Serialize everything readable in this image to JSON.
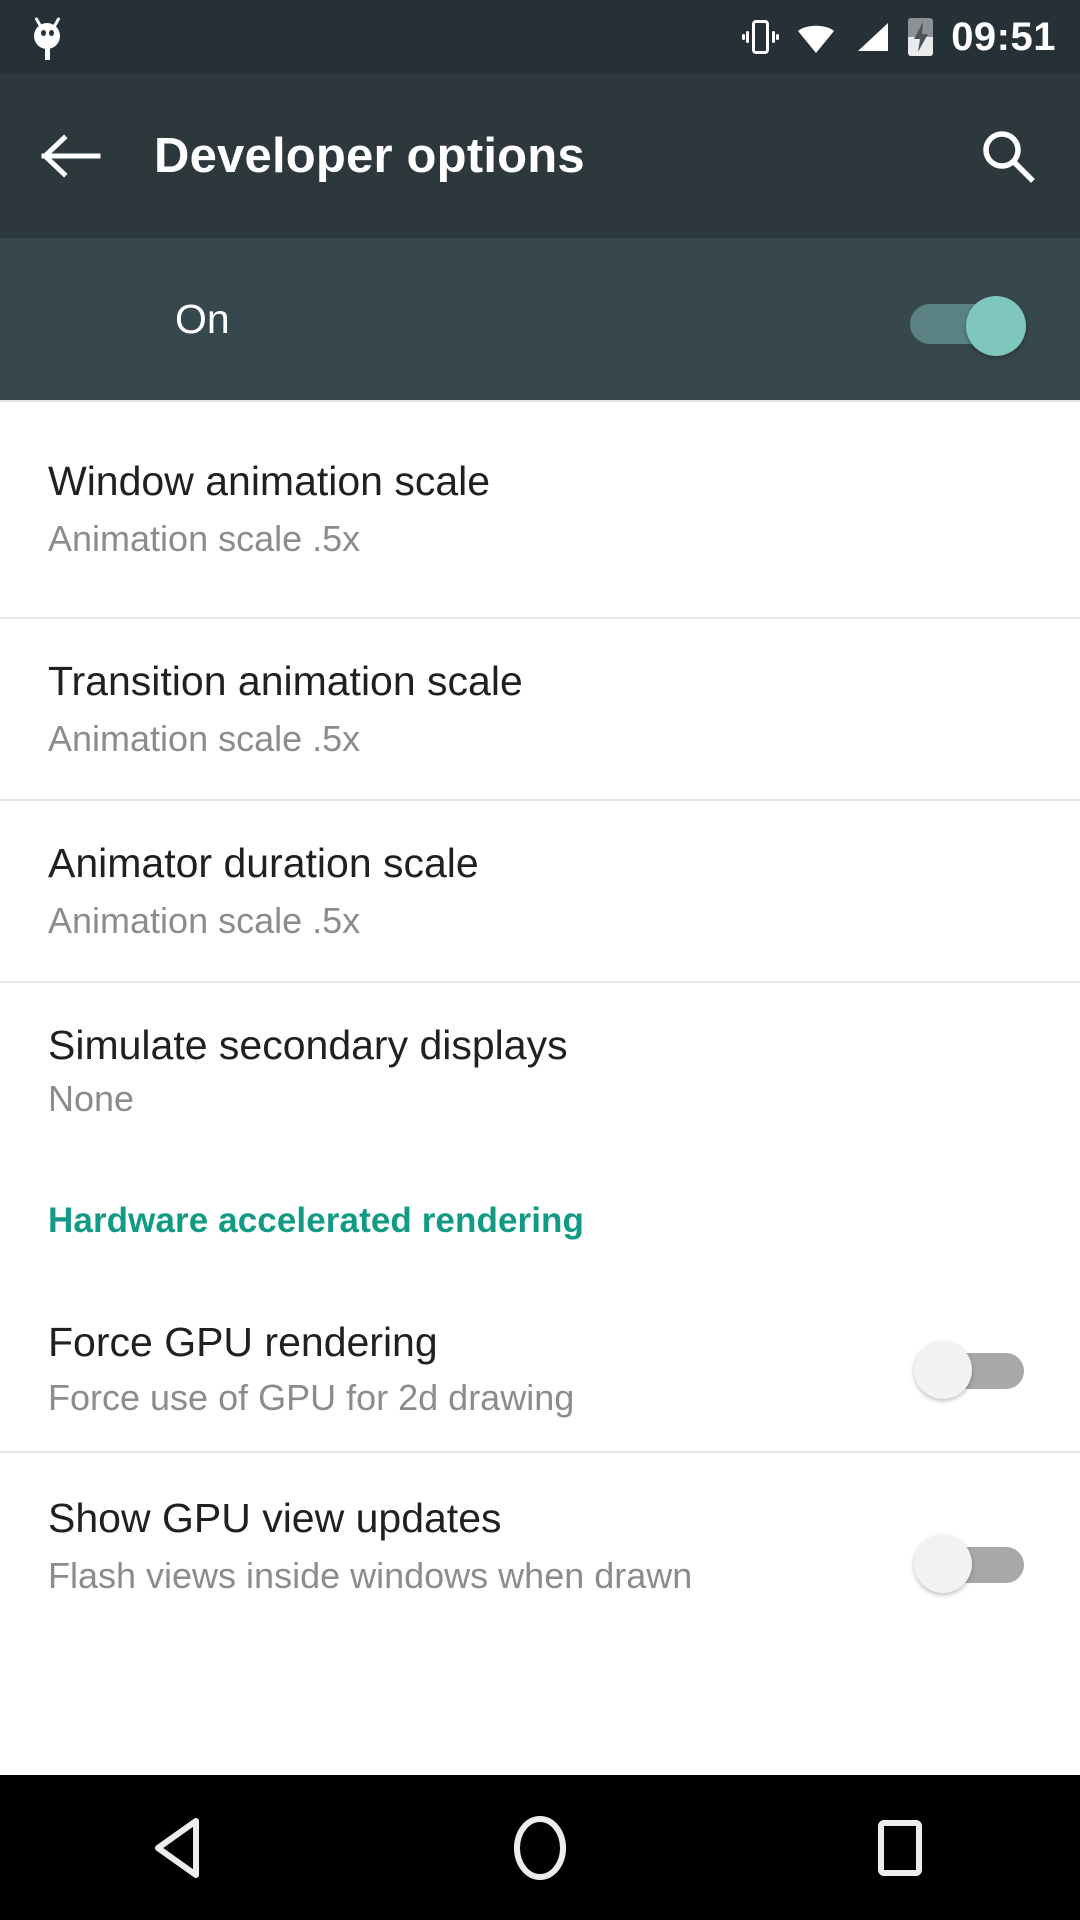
{
  "statusbar": {
    "time": "09:51",
    "icons": [
      {
        "name": "usb-debugging-bug-icon"
      },
      {
        "name": "vibrate-icon"
      },
      {
        "name": "wifi-icon"
      },
      {
        "name": "cellular-signal-icon"
      },
      {
        "name": "battery-charging-icon"
      }
    ]
  },
  "toolbar": {
    "title": "Developer options",
    "back_icon": "back-arrow-icon",
    "search_icon": "search-icon"
  },
  "master_switch": {
    "label": "On",
    "state": "on"
  },
  "list": [
    {
      "id": "window-animation-scale",
      "title": "Window animation scale",
      "subtitle": "Animation scale .5x",
      "control": "none"
    },
    {
      "id": "transition-animation-scale",
      "title": "Transition animation scale",
      "subtitle": "Animation scale .5x",
      "control": "none"
    },
    {
      "id": "animator-duration-scale",
      "title": "Animator duration scale",
      "subtitle": "Animation scale .5x",
      "control": "none"
    },
    {
      "id": "simulate-secondary-displays",
      "title": "Simulate secondary displays",
      "subtitle": "None",
      "control": "none"
    }
  ],
  "section": {
    "header": "Hardware accelerated rendering"
  },
  "toggles": [
    {
      "id": "force-gpu-rendering",
      "title": "Force GPU rendering",
      "subtitle": "Force use of GPU for 2d drawing",
      "state": "off"
    },
    {
      "id": "show-gpu-view-updates",
      "title": "Show GPU view updates",
      "subtitle": "Flash views inside windows when drawn",
      "state": "off"
    }
  ],
  "navbar": {
    "back": "back-nav-icon",
    "home": "home-nav-icon",
    "recents": "recents-nav-icon"
  },
  "colors": {
    "statusbar_bg": "#263137",
    "toolbar_bg": "#2d383d",
    "master_bg": "#37474e",
    "accent_teal": "#129b84",
    "switch_on_thumb": "#7fc6bd",
    "switch_on_track": "#5b8282",
    "switch_off_thumb": "#f2f2f2",
    "switch_off_track": "#a8a8a8",
    "title_text": "#1e2123",
    "subtitle_text": "#8a8d8f",
    "navbar_bg": "#000000"
  }
}
